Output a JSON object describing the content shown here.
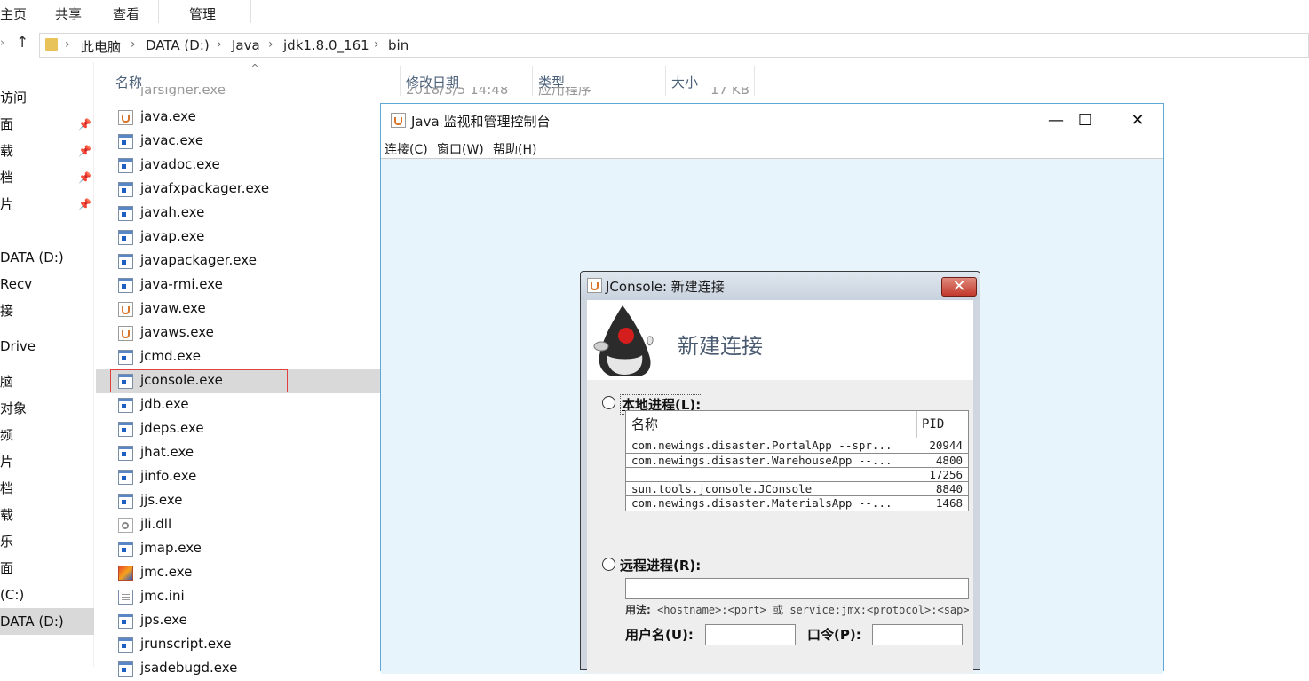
{
  "ribbon": {
    "tabs": [
      "主页",
      "共享",
      "查看",
      "管理"
    ]
  },
  "breadcrumb": [
    "此电脑",
    "DATA (D:)",
    "Java",
    "jdk1.8.0_161",
    "bin"
  ],
  "nav": {
    "items": [
      "访问",
      "面",
      "载",
      "档",
      "片",
      "DATA (D:)",
      "Recv",
      "接",
      "Drive",
      "脑",
      "对象",
      "频",
      "片",
      "档",
      "载",
      "乐",
      "面",
      "(C:)",
      "DATA (D:)"
    ]
  },
  "columns": {
    "name": "名称",
    "date": "修改日期",
    "type": "类型",
    "size": "大小"
  },
  "partial_row": {
    "name": "jarsigner.exe",
    "date": "2018/3/5 14:48",
    "type": "应用程序",
    "size": "17 KB"
  },
  "files": [
    {
      "name": "java.exe",
      "icon": "java-icon"
    },
    {
      "name": "javac.exe",
      "icon": "exe-icon"
    },
    {
      "name": "javadoc.exe",
      "icon": "exe-icon"
    },
    {
      "name": "javafxpackager.exe",
      "icon": "exe-icon"
    },
    {
      "name": "javah.exe",
      "icon": "exe-icon"
    },
    {
      "name": "javap.exe",
      "icon": "exe-icon"
    },
    {
      "name": "javapackager.exe",
      "icon": "exe-icon"
    },
    {
      "name": "java-rmi.exe",
      "icon": "exe-icon"
    },
    {
      "name": "javaw.exe",
      "icon": "java-icon"
    },
    {
      "name": "javaws.exe",
      "icon": "java-icon"
    },
    {
      "name": "jcmd.exe",
      "icon": "exe-icon"
    },
    {
      "name": "jconsole.exe",
      "icon": "exe-icon"
    },
    {
      "name": "jdb.exe",
      "icon": "exe-icon"
    },
    {
      "name": "jdeps.exe",
      "icon": "exe-icon"
    },
    {
      "name": "jhat.exe",
      "icon": "exe-icon"
    },
    {
      "name": "jinfo.exe",
      "icon": "exe-icon"
    },
    {
      "name": "jjs.exe",
      "icon": "exe-icon"
    },
    {
      "name": "jli.dll",
      "icon": "dll-icon"
    },
    {
      "name": "jmap.exe",
      "icon": "exe-icon"
    },
    {
      "name": "jmc.exe",
      "icon": "jmc-icon"
    },
    {
      "name": "jmc.ini",
      "icon": "ini-icon"
    },
    {
      "name": "jps.exe",
      "icon": "exe-icon"
    },
    {
      "name": "jrunscript.exe",
      "icon": "exe-icon"
    },
    {
      "name": "jsadebugd.exe",
      "icon": "exe-icon"
    }
  ],
  "selected_file": "jconsole.exe",
  "javawin": {
    "title": "Java 监视和管理控制台",
    "menu": [
      "连接(C)",
      "窗口(W)",
      "帮助(H)"
    ],
    "controls": {
      "min": "—",
      "max": "☐",
      "close": "✕"
    }
  },
  "dialog": {
    "title": "JConsole: 新建连接",
    "heading": "新建连接",
    "local_label": "本地进程(L):",
    "table_headers": {
      "name": "名称",
      "pid": "PID"
    },
    "processes": [
      {
        "name": "com.newings.disaster.PortalApp --spr...",
        "pid": "20944"
      },
      {
        "name": "com.newings.disaster.WarehouseApp --...",
        "pid": "4800"
      },
      {
        "name": "",
        "pid": "17256"
      },
      {
        "name": "sun.tools.jconsole.JConsole",
        "pid": "8840"
      },
      {
        "name": "com.newings.disaster.MaterialsApp --...",
        "pid": "1468"
      }
    ],
    "remote_label": "远程进程(R):",
    "remote_value": "",
    "usage_label": "用法:",
    "usage_text": "<hostname>:<port> 或 service:jmx:<protocol>:<sap>",
    "username_label": "用户名(U):",
    "password_label": "口令(P):",
    "close_glyph": "✕"
  },
  "colors": {
    "accent": "#5fa8d8",
    "selection": "#d9d9d9",
    "highlight_box": "#e04040"
  }
}
